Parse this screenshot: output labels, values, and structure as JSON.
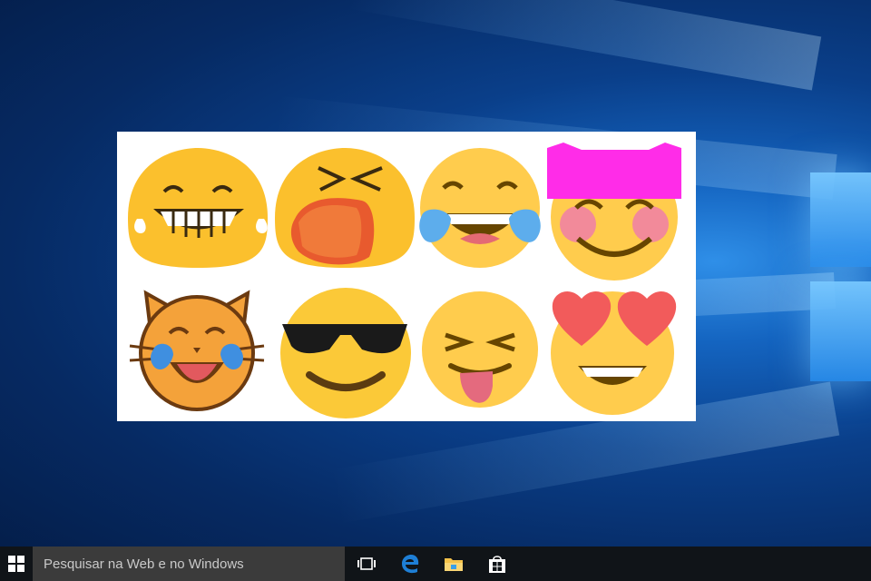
{
  "desktop": {
    "image": {
      "emojis": [
        {
          "icon": "grinning-tears-blob-icon"
        },
        {
          "icon": "tired-face-blob-icon"
        },
        {
          "icon": "tears-of-joy-icon"
        },
        {
          "icon": "smiling-pink-hat-icon"
        },
        {
          "icon": "cat-tears-of-joy-icon"
        },
        {
          "icon": "sunglasses-smile-icon"
        },
        {
          "icon": "squinting-tongue-icon"
        },
        {
          "icon": "heart-eyes-icon"
        }
      ]
    }
  },
  "taskbar": {
    "start_icon": "windows-logo-icon",
    "search_placeholder": "Pesquisar na Web e no Windows",
    "icons": [
      "task-view-icon",
      "edge-browser-icon",
      "file-explorer-icon",
      "store-icon"
    ],
    "colors": {
      "background": "#101418",
      "search_bg": "#3b3b3b",
      "edge_blue": "#1e7fd6"
    }
  }
}
